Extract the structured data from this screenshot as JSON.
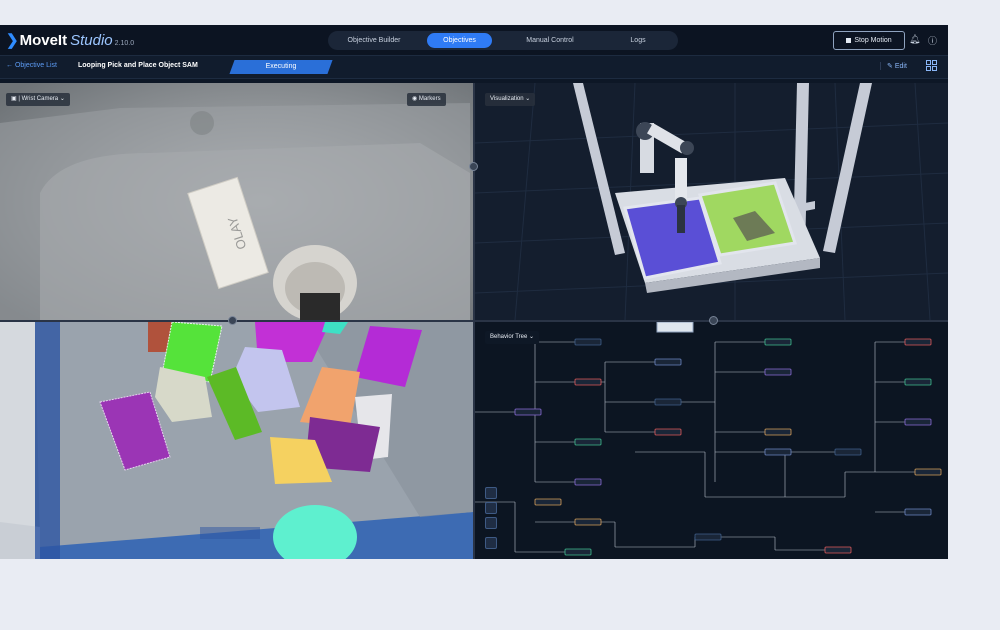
{
  "app": {
    "brand_name": "MoveIt",
    "brand_studio": "Studio",
    "version": "2.10.0",
    "accent_color": "#2f7bf5"
  },
  "nav": {
    "tabs": [
      {
        "label": "Objective Builder",
        "active": false
      },
      {
        "label": "Objectives",
        "active": true
      },
      {
        "label": "Manual Control",
        "active": false
      },
      {
        "label": "Logs",
        "active": false
      }
    ]
  },
  "header": {
    "stop_label": "Stop Motion",
    "bell_icon": "bell-icon",
    "help_icon": "help-icon"
  },
  "subheader": {
    "back_label": "Objective List",
    "objective_name": "Looping Pick and Place Object SAM",
    "status": "Executing",
    "edit_label": "Edit",
    "layout_icon": "grid-layout-icon"
  },
  "panes": {
    "camera": {
      "selector_label": "Wrist Camera",
      "markers_label": "Markers"
    },
    "visualization": {
      "selector_label": "Visualization"
    },
    "segmentation": {},
    "behavior_tree": {
      "selector_label": "Behavior Tree"
    }
  },
  "scene_text": {
    "box_logo": "OLAY"
  }
}
